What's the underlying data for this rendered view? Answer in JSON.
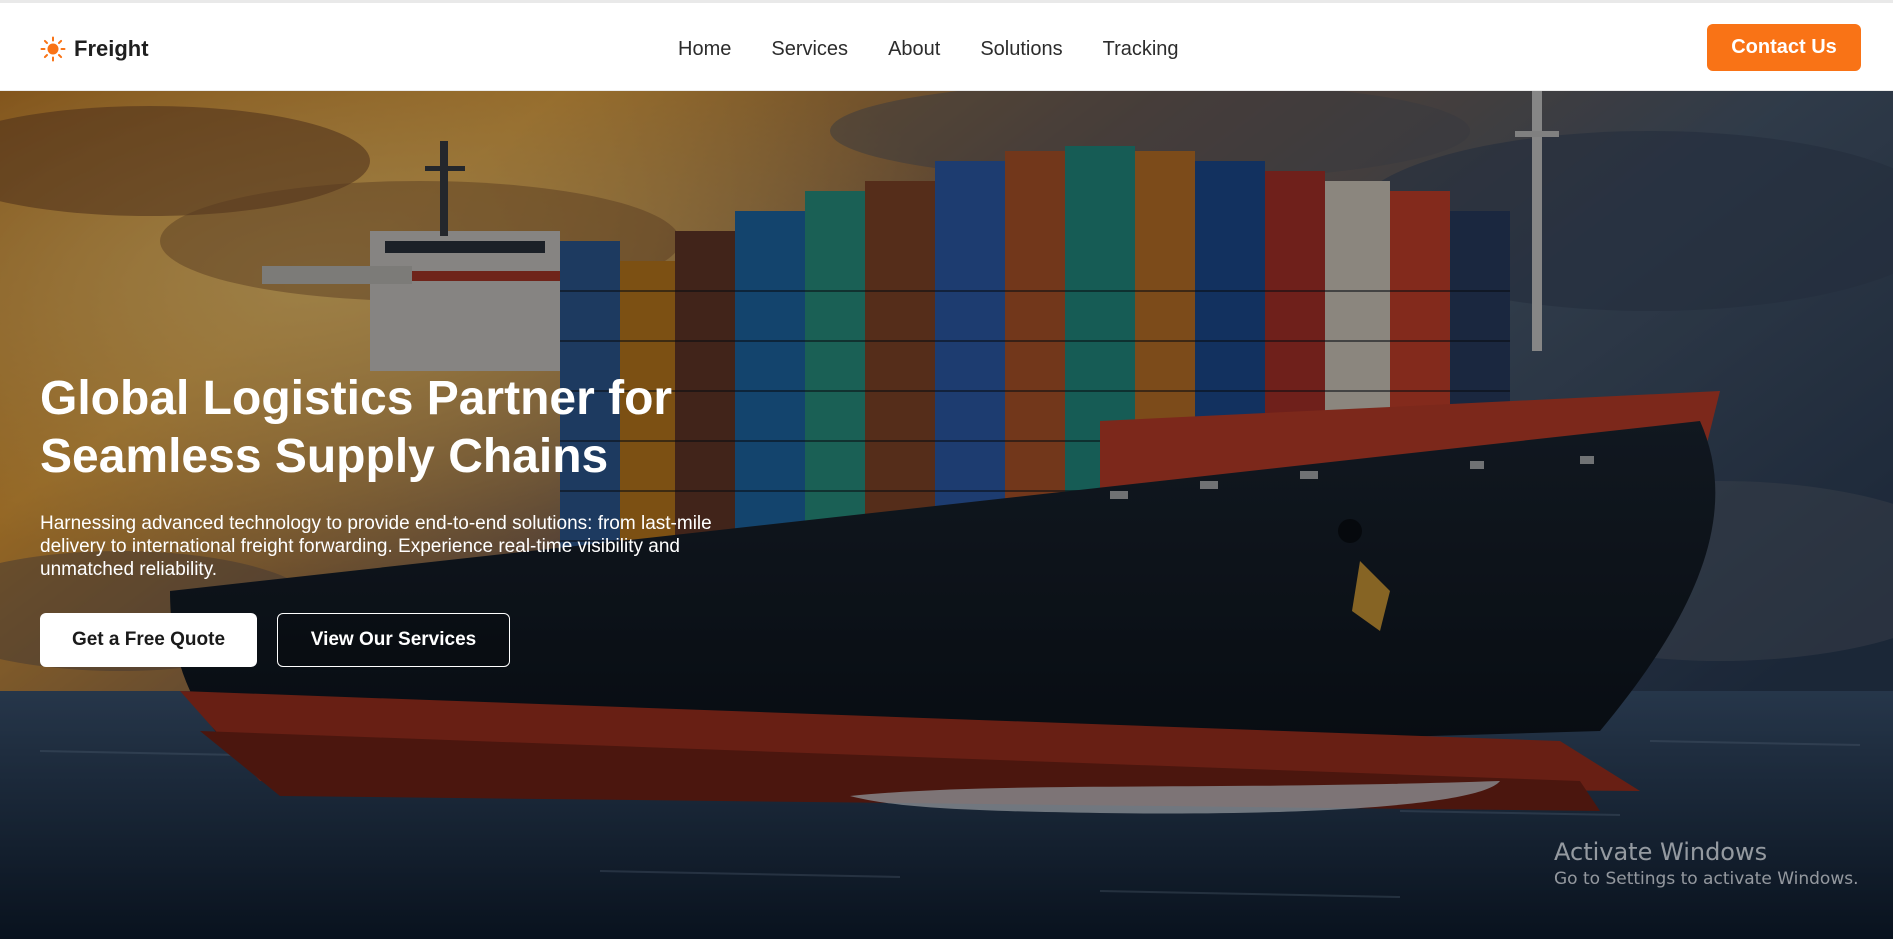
{
  "brand": {
    "name": "Freight",
    "icon": "sun-icon",
    "accent_color": "#f97316"
  },
  "nav": {
    "items": [
      {
        "label": "Home"
      },
      {
        "label": "Services"
      },
      {
        "label": "About"
      },
      {
        "label": "Solutions"
      },
      {
        "label": "Tracking"
      }
    ],
    "contact_label": "Contact Us"
  },
  "hero": {
    "title": "Global Logistics Partner for Seamless Supply Chains",
    "subtitle": "Harnessing advanced technology to provide end-to-end solutions: from last-mile delivery to international freight forwarding. Experience real-time visibility and unmatched reliability.",
    "primary_cta": "Get a Free Quote",
    "secondary_cta": "View Our Services",
    "background_image": "cargo-ship-at-sea-sunset"
  },
  "watermark": {
    "title": "Activate Windows",
    "subtitle": "Go to Settings to activate Windows."
  }
}
